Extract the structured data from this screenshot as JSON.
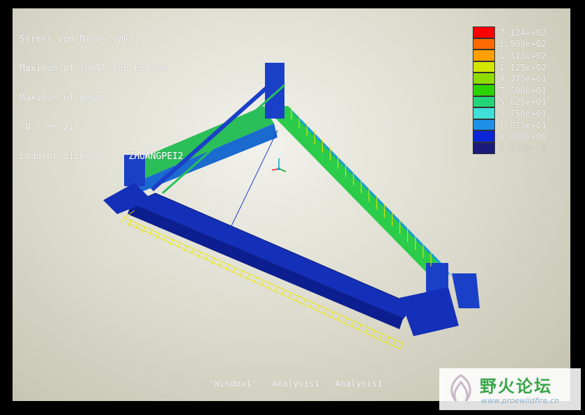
{
  "header": {
    "lines": [
      "Stress von Mises (WCS)",
      "Maximum of shell top/bottom",
      "Maximum of beam",
      "(N / mm^2)",
      "Loadset:zizhong :   ZHUANGPEI2"
    ]
  },
  "legend": {
    "entries": [
      {
        "label": "7.124e+02",
        "color": "#ff0000"
      },
      {
        "label": "1.500e+02",
        "color": "#ff6a00"
      },
      {
        "label": "1.313e+02",
        "color": "#ffa000"
      },
      {
        "label": "1.125e+02",
        "color": "#d4e600"
      },
      {
        "label": "9.375e+01",
        "color": "#8edb00"
      },
      {
        "label": "7.500e+01",
        "color": "#2bd400"
      },
      {
        "label": "5.625e+01",
        "color": "#25d478"
      },
      {
        "label": "3.750e+01",
        "color": "#40e0d8"
      },
      {
        "label": "1.875e+01",
        "color": "#1e90e8"
      },
      {
        "label": "0.000e+00",
        "color": "#0a26d8"
      }
    ],
    "bottom_label": "2.513e-13",
    "bottom_color": "#1a1a7a"
  },
  "window_caption": "\"Window1\" - Analysis1 - Analysis1",
  "watermark": {
    "title": "野火论坛",
    "url": "www.proewildfire.cn"
  }
}
